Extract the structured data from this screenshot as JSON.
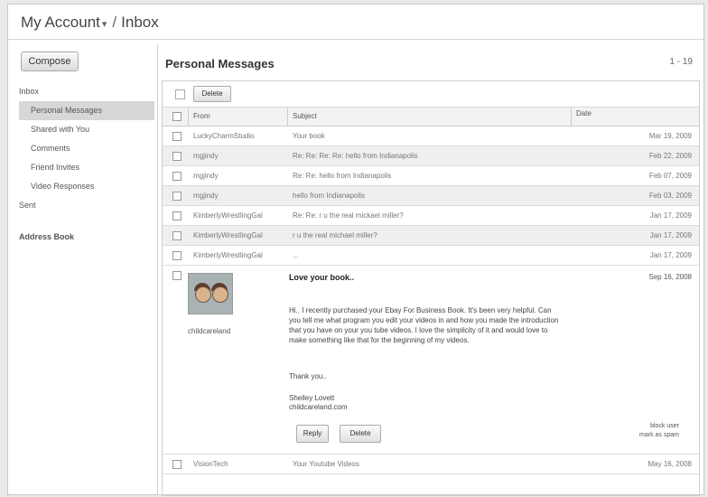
{
  "header": {
    "account": "My Account",
    "caret": "▾",
    "sep": "/",
    "section": "Inbox"
  },
  "sidebar": {
    "compose": "Compose",
    "items": [
      {
        "label": "Inbox"
      },
      {
        "label": "Personal Messages"
      },
      {
        "label": "Shared with You"
      },
      {
        "label": "Comments"
      },
      {
        "label": "Friend Invites"
      },
      {
        "label": "Video Responses"
      },
      {
        "label": "Sent"
      }
    ],
    "address_book": "Address Book"
  },
  "main": {
    "title": "Personal Messages",
    "count": "1 - 19",
    "toolbar": {
      "delete": "Delete"
    },
    "columns": {
      "from": "From",
      "subject": "Subject",
      "date": "Date"
    },
    "messages": [
      {
        "from": "LuckyCharmStudio",
        "subject": "Your book",
        "date": "Mar 19, 2009"
      },
      {
        "from": "mgjindy",
        "subject": "Re: Re: Re: Re: hello from Indianapolis",
        "date": "Feb 22, 2009"
      },
      {
        "from": "mgjindy",
        "subject": "Re: Re: hello from Indianapolis",
        "date": "Feb 07, 2009"
      },
      {
        "from": "mgjindy",
        "subject": "hello from Indianapolis",
        "date": "Feb 03, 2009"
      },
      {
        "from": "KimberlyWrestlingGal",
        "subject": "Re: Re: r u the real mickael miller?",
        "date": "Jan 17, 2009"
      },
      {
        "from": "KimberlyWrestlingGal",
        "subject": "r u the real michael miller?",
        "date": "Jan 17, 2009"
      },
      {
        "from": "KimberlyWrestlingGal",
        "subject": "...",
        "date": "Jan 17, 2009"
      }
    ],
    "open_message": {
      "username": "childcareland",
      "subject": "Love your book..",
      "date": "Sep 16, 2008",
      "body": "Hi.. I recently purchased your Ebay For Business Book. It's been very helpful. Can you tell me what program you edit your videos in and how you made the introduction that you have on your you tube videos. I love the simplicity of it and would love to make something like that for the beginning of my videos.",
      "thanks": "Thank you..",
      "sig_name": "Shelley Lovett",
      "sig_site": "childcareland.com",
      "reply": "Reply",
      "delete": "Delete",
      "block_user": "block user",
      "mark_spam": "mark as spam"
    },
    "last_message": {
      "from": "VisionTech",
      "subject": "Your Youtube Videos",
      "date": "May 16, 2008"
    }
  }
}
